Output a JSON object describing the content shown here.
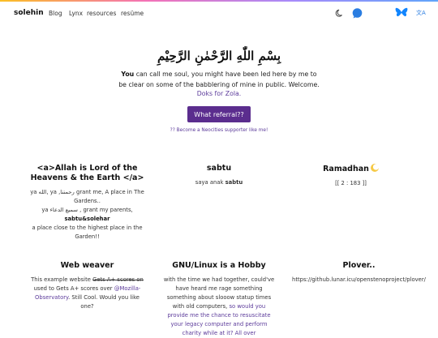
{
  "header": {
    "brand": "solehin",
    "nav": [
      "Blog",
      "Lynx",
      "resources",
      "resüme"
    ],
    "translate_glyph": "文A",
    "icons": [
      "moon-icon",
      "chat-bubble-icon",
      "butterfly-icon",
      "translate-icon"
    ]
  },
  "hero": {
    "bismillah": "بِسْمِ اللّٰهِ الرَّحْمٰنِ الرَّحِيْمِ",
    "intro_bold": "You",
    "intro_text": " can call me soul, you might have been led here by me to be clear on some of the babblering of mine in public. Welcome.",
    "doks_link": "Doks for Zola.",
    "cta": "What referral??",
    "neocities": "?? Become a Neocities supporter like me!"
  },
  "cards": {
    "allah": {
      "title": "<a>Allah is Lord of the Heavens & the Earth </a>",
      "l1": "ya الله, ya ,رحمننا grant me, A place in The Gardens..",
      "l2": "ya سميع الدعاء , grant my parents,",
      "l3": "sabtu&solehar",
      "l4": "a place close to the highest place in the Garden!!"
    },
    "sabtu": {
      "title": "sabtu",
      "pre": "saya anak ",
      "bold": "sabtu"
    },
    "ramadhan": {
      "title": "Ramadhan",
      "text": "[[ 2 : 183 ]]"
    },
    "web": {
      "title": "Web weaver",
      "p1": "This example website ",
      "strike": "Gets A+ scores on",
      "p2": " used to Gets A+ scores over ",
      "link": "@Mozilla-Observatory",
      "p3": ". Still Cool. Would you like one?"
    },
    "gnu": {
      "title": "GNU/Linux is a Hobby",
      "p1": "with the time we had together, could've have heard me rage something something about slooow statup times with old computers, ",
      "link": "so would you provide me the chance to resuscitate your legacy computer and perform charity while at it? All over"
    },
    "plover": {
      "title": "Plover..",
      "text": "https://github.lunar.icu/openstenoproject/plover/"
    }
  },
  "colors": {
    "accent": "#5b2d8e",
    "link": "#5b3a9a",
    "chat": "#2a7de1"
  }
}
